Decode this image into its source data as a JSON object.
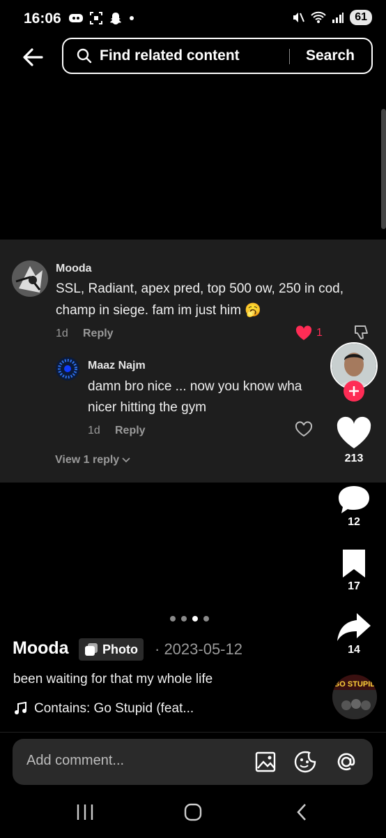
{
  "status_bar": {
    "time": "16:06",
    "battery": "61"
  },
  "search": {
    "placeholder": "Find related content",
    "button_label": "Search"
  },
  "comments": [
    {
      "author": "Mooda",
      "text": "SSL, Radiant, apex pred, top 500 ow, 250 in cod, champ in siege. fam im just him 🥱",
      "time": "1d",
      "reply_label": "Reply",
      "like_count": "1",
      "replies": [
        {
          "author": "Maaz Najm",
          "text_line1": "damn bro nice ... now you know wha",
          "text_line2": "nicer hitting the gym",
          "time": "1d",
          "reply_label": "Reply"
        }
      ],
      "view_replies_label": "View 1 reply"
    }
  ],
  "rail": {
    "likes": "213",
    "comments": "12",
    "saves": "17",
    "shares": "14"
  },
  "post": {
    "author": "Mooda",
    "badge_label": "Photo",
    "date": "· 2023-05-12",
    "caption": "been waiting for that my whole life",
    "music": "Contains: Go Stupid (feat...",
    "music_disc_text": "GO STUPID"
  },
  "comment_input": {
    "placeholder": "Add comment..."
  },
  "colors": {
    "like_red": "#fe2c55",
    "panel_bg": "#1e1e1e"
  }
}
